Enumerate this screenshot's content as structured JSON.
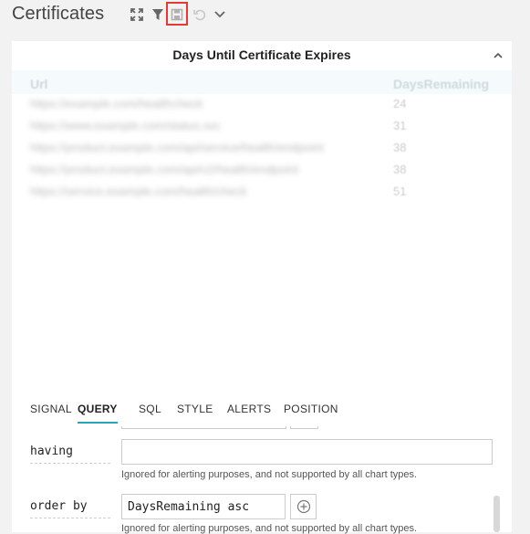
{
  "header": {
    "title": "Certificates",
    "toolbar": [
      "fullscreen-icon",
      "filter-icon",
      "save-icon",
      "undo-icon",
      "chevron-down-icon"
    ]
  },
  "panel": {
    "title": "Days Until Certificate Expires",
    "columns": [
      "Url",
      "DaysRemaining"
    ],
    "rows": [
      {
        "url": "https://example.com/healthcheck",
        "days": "24"
      },
      {
        "url": "https://www.example.com/status.svc",
        "days": "31"
      },
      {
        "url": "https://product.example.com/api/service/health/endpoint",
        "days": "38"
      },
      {
        "url": "https://product.example.com/api/v2/health/endpoint",
        "days": "38"
      },
      {
        "url": "https://service.example.com/health/check",
        "days": "51"
      }
    ]
  },
  "tabs": [
    "SIGNAL",
    "QUERY",
    "SQL",
    "STYLE",
    "ALERTS",
    "POSITION"
  ],
  "active_tab": "QUERY",
  "form": {
    "having_label": "having",
    "having_value": "",
    "having_hint": "Ignored for alerting purposes, and not supported by all chart types.",
    "order_label": "order by",
    "order_value": "DaysRemaining asc",
    "order_hint": "Ignored for alerting purposes, and not supported by all chart types."
  },
  "colors": {
    "accent": "#26a7b7",
    "highlight": "#e53935"
  }
}
